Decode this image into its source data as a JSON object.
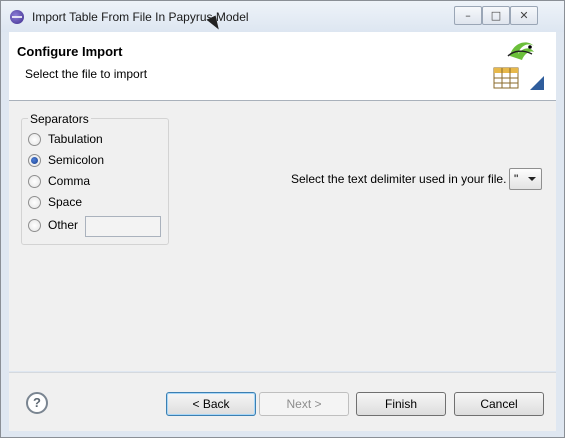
{
  "window": {
    "title": "Import Table From File In Papyrus Model"
  },
  "banner": {
    "title": "Configure Import",
    "description": "Select the file to import"
  },
  "separators": {
    "group_label": "Separators",
    "options": [
      {
        "label": "Tabulation",
        "checked": false
      },
      {
        "label": "Semicolon",
        "checked": true
      },
      {
        "label": "Comma",
        "checked": false
      },
      {
        "label": "Space",
        "checked": false
      },
      {
        "label": "Other",
        "checked": false
      }
    ],
    "other_value": ""
  },
  "delimiter": {
    "label": "Select the text delimiter used in your file.",
    "selected": "\""
  },
  "buttons": {
    "back": "< Back",
    "next": "Next >",
    "finish": "Finish",
    "cancel": "Cancel"
  }
}
